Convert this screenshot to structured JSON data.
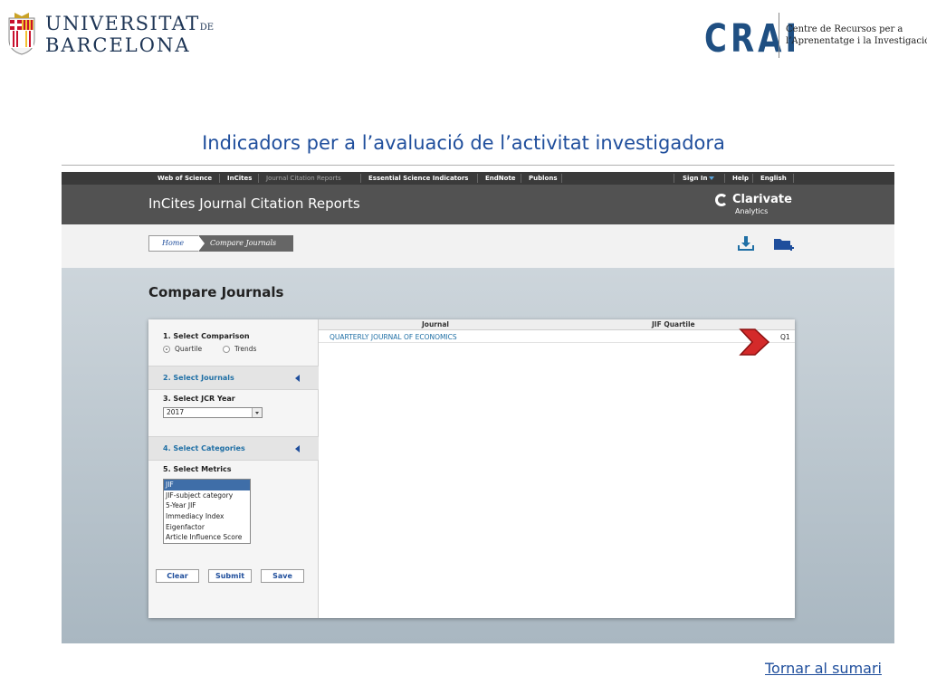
{
  "header": {
    "ub_logo": {
      "line1": "UNIVERSITAT",
      "line1_suffix": "DE",
      "line2": "BARCELONA"
    },
    "crai_logo": {
      "mark": "CRAI",
      "name_line1": "Centre de Recursos per a",
      "name_line2": "l’Aprenentatge i la Investigació"
    },
    "title": "Indicadors per a l’avaluació de l’activitat investigadora"
  },
  "jcr": {
    "topnav": {
      "left_items": [
        "Web of Science",
        "InCites",
        "Journal Citation Reports",
        "Essential Science Indicators",
        "EndNote",
        "Publons"
      ],
      "active_item": "Journal Citation Reports",
      "sign_in": "Sign In",
      "help": "Help",
      "language": "English"
    },
    "banner": {
      "title": "InCites Journal Citation Reports",
      "brand_name": "Clarivate",
      "brand_sub": "Analytics"
    },
    "breadcrumb": {
      "home": "Home",
      "current": "Compare Journals"
    },
    "toolbar_icons": [
      "download-icon",
      "add-folder-icon"
    ],
    "page_heading": "Compare Journals",
    "sidebar": {
      "comparison_heading": "1. Select Comparison",
      "radio_options": [
        {
          "label": "Quartile",
          "selected": true
        },
        {
          "label": "Trends",
          "selected": false
        }
      ],
      "journals_heading": "2. Select Journals",
      "jcr_year_heading": "3. Select JCR Year",
      "jcr_year_value": "2017",
      "categories_heading": "4. Select Categories",
      "metrics_heading": "5. Select Metrics",
      "metrics": [
        "JIF",
        "JIF-subject category",
        "5-Year JIF",
        "Immediacy Index",
        "Eigenfactor",
        "Article Influence Score"
      ],
      "selected_metric": "JIF",
      "buttons": {
        "clear": "Clear",
        "submit": "Submit",
        "save": "Save"
      }
    },
    "table": {
      "headers": {
        "journal": "Journal",
        "quartile": "JIF Quartile"
      },
      "rows": [
        {
          "journal": "QUARTERLY JOURNAL OF ECONOMICS",
          "quartile": "Q1"
        }
      ]
    },
    "annotation_arrow_color": "#d42a2a"
  },
  "footer": {
    "back_link": "Tornar al sumari"
  },
  "colors": {
    "title_blue": "#1f4e9c",
    "crai_blue": "#1f4f82",
    "nav_dark": "#3a3a3a",
    "banner_gray": "#525252",
    "link_blue": "#1f6fa5"
  }
}
